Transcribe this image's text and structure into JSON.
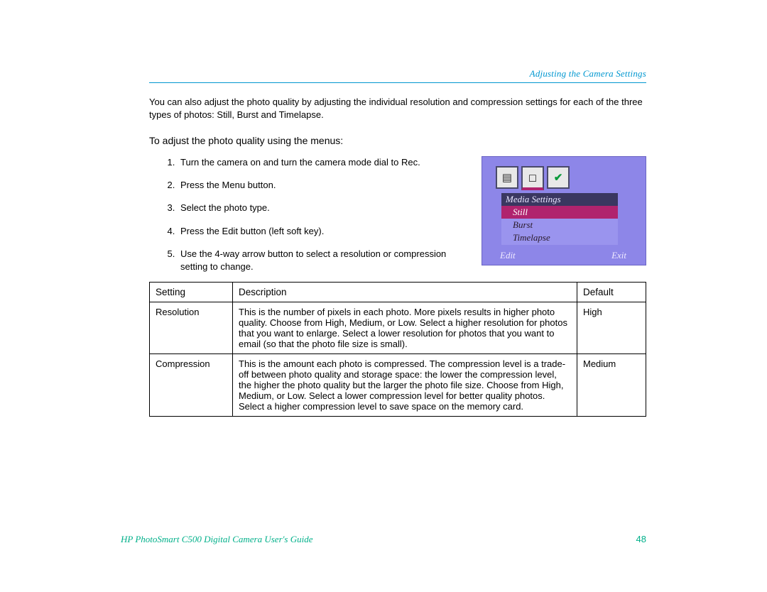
{
  "header": {
    "title": "Adjusting the Camera Settings"
  },
  "intro": "You can also adjust the photo quality by adjusting the individual resolution and compression settings for each of the three types of photos: Still, Burst and Timelapse.",
  "subhead": "To adjust the photo quality using the menus:",
  "steps": [
    {
      "pre": "Turn the camera on and turn the camera mode dial to ",
      "em": "Rec",
      "post": "."
    },
    {
      "pre": "Press the ",
      "em": "Menu",
      "post": " button."
    },
    {
      "pre": "Select the photo type.",
      "em": "",
      "post": ""
    },
    {
      "pre": "Press the ",
      "em": "Edit",
      "post": " button (left soft key)."
    },
    {
      "pre": "Use the 4-way arrow button to select a resolution or compression setting to change.",
      "em": "",
      "post": ""
    }
  ],
  "lcd": {
    "menu_header": "Media Settings",
    "items": [
      "Still",
      "Burst",
      "Timelapse"
    ],
    "soft_left": "Edit",
    "soft_right": "Exit"
  },
  "table": {
    "headers": [
      "Setting",
      "Description",
      "Default"
    ],
    "rows": [
      {
        "setting": "Resolution",
        "description": "This is the number of pixels in each photo. More pixels results in higher photo quality. Choose from High, Medium, or Low. Select a higher resolution for photos that you want to enlarge. Select a lower resolution for photos that you want to email (so that the photo file size is small).",
        "default": "High"
      },
      {
        "setting": "Compression",
        "description": "This is the amount each photo is compressed. The compression level is a trade-off between photo quality and storage space: the lower the compression level, the higher the photo quality but the larger the photo file size. Choose from High, Medium, or Low. Select a lower compression level for better quality photos. Select a higher compression level to save space on the memory card.",
        "default": "Medium"
      }
    ]
  },
  "footer": {
    "guide": "HP PhotoSmart C500 Digital Camera User's Guide",
    "page": "48"
  }
}
